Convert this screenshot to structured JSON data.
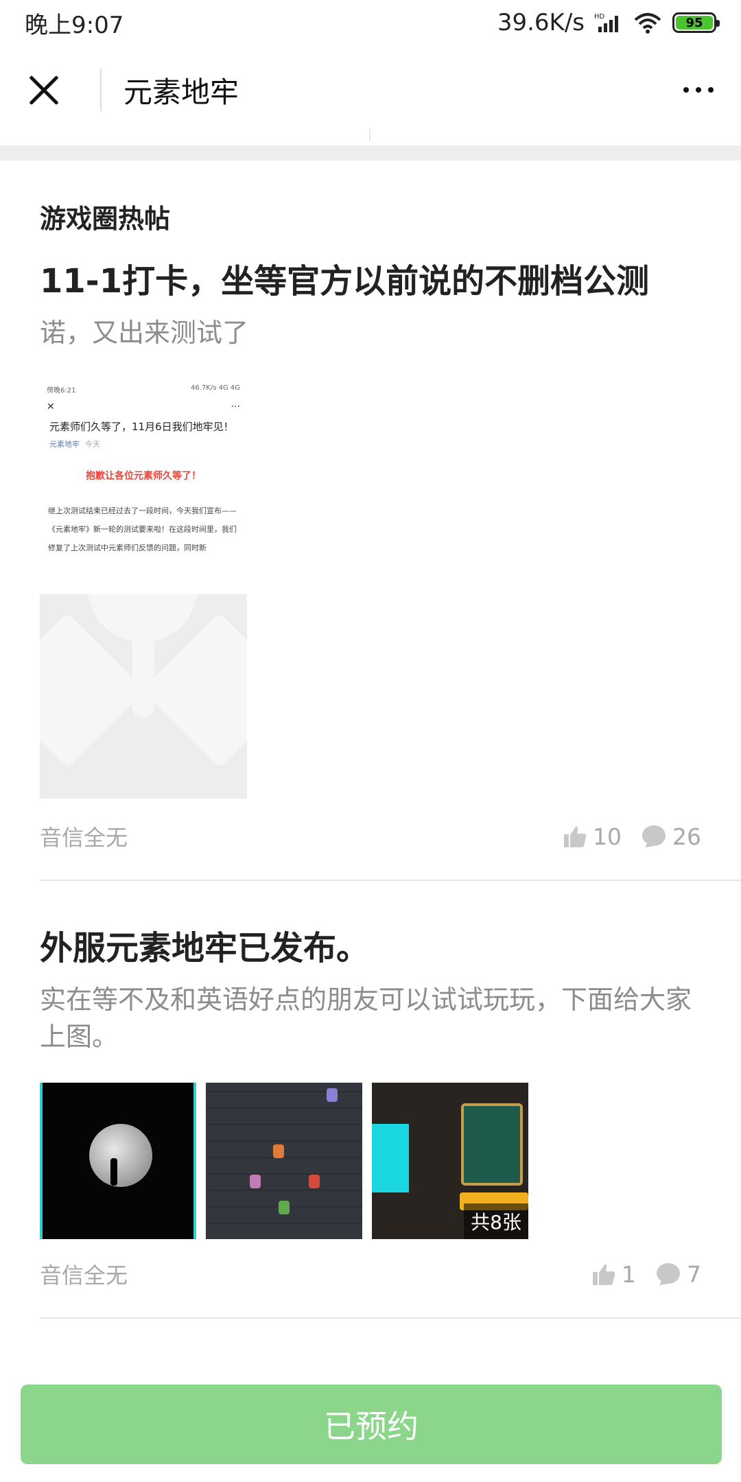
{
  "status_bar": {
    "time": "晚上9:07",
    "speed": "39.6K/s",
    "battery": "95"
  },
  "nav": {
    "title": "元素地牢"
  },
  "section": {
    "title": "游戏圈热帖"
  },
  "posts": [
    {
      "title": "11-1打卡，坐等官方以前说的不删档公测",
      "desc": "诺，又出来测试了",
      "author": "音信全无",
      "likes": "10",
      "comments": "26",
      "screenshot": {
        "time": "傍晚6:21",
        "net": "46.7K/s 4G 4G",
        "title": "元素师们久等了，11月6日我们地牢见！",
        "account": "元素地牢",
        "date": "今天",
        "highlight": "抱歉让各位元素师久等了！",
        "body": "继上次测试结束已经过去了一段时间，今天我们宣布——《元素地牢》新一轮的测试要来啦！在这段时间里，我们修复了上次测试中元素师们反馈的问题，同时新"
      }
    },
    {
      "title": "外服元素地牢已发布。",
      "desc": "实在等不及和英语好点的朋友可以试试玩玩，下面给大家上图。",
      "author": "音信全无",
      "likes": "1",
      "comments": "7",
      "image_count": "共8张"
    }
  ],
  "bottom_button": {
    "label": "已预约"
  }
}
